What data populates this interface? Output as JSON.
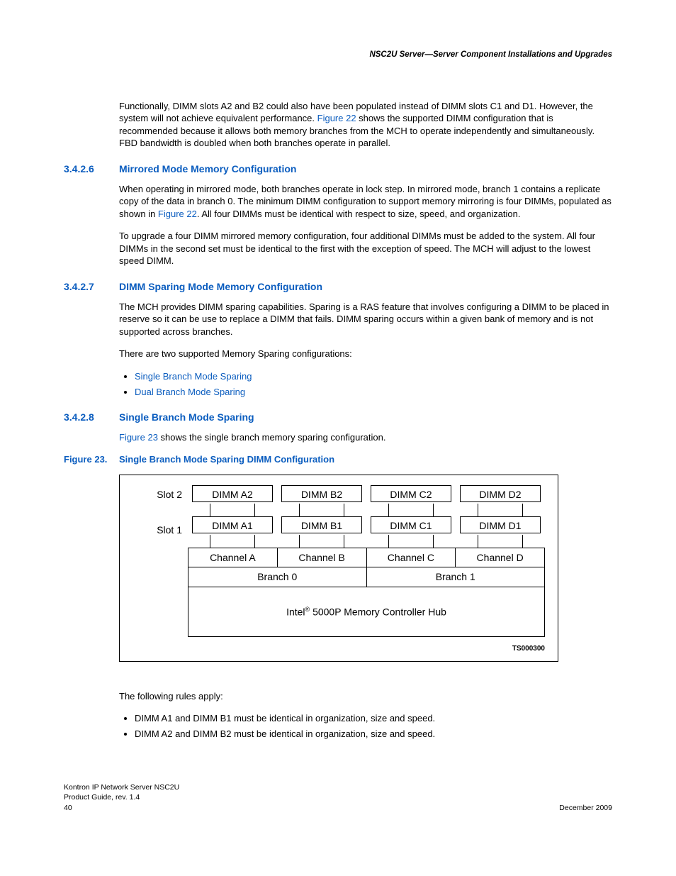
{
  "header": "NSC2U Server—Server Component Installations and Upgrades",
  "intro": {
    "p1a": "Functionally, DIMM slots A2 and B2 could also have been populated instead of DIMM slots C1 and D1. However, the system will not achieve equivalent performance. ",
    "p1link": "Figure 22",
    "p1b": " shows the supported DIMM configuration that is recommended because it allows both memory branches from the MCH to operate independently and simultaneously. FBD bandwidth is doubled when both branches operate in parallel."
  },
  "s1": {
    "num": "3.4.2.6",
    "title": "Mirrored Mode Memory Configuration",
    "p1a": "When operating in mirrored mode, both branches operate in lock step. In mirrored mode, branch 1 contains a replicate copy of the data in branch 0. The minimum DIMM configuration to support memory mirroring is four DIMMs, populated as shown in ",
    "p1link": "Figure 22",
    "p1b": ". All four DIMMs must be identical with respect to size, speed, and organization.",
    "p2": "To upgrade a four DIMM mirrored memory configuration, four additional DIMMs must be added to the system. All four DIMMs in the second set must be identical to the first with the exception of speed. The MCH will adjust to the lowest speed DIMM."
  },
  "s2": {
    "num": "3.4.2.7",
    "title": "DIMM Sparing Mode Memory Configuration",
    "p1": "The MCH provides DIMM sparing capabilities. Sparing is a RAS feature that involves configuring a DIMM to be placed in reserve so it can be use to replace a DIMM that fails. DIMM sparing occurs within a given bank of memory and is not supported across branches.",
    "p2": "There are two supported Memory Sparing configurations:",
    "li1": "Single Branch Mode Sparing",
    "li2": "Dual Branch Mode Sparing"
  },
  "s3": {
    "num": "3.4.2.8",
    "title": "Single Branch Mode Sparing",
    "p1link": "Figure 23",
    "p1b": " shows the single branch memory sparing configuration."
  },
  "fig": {
    "num": "Figure 23.",
    "title": "Single Branch Mode Sparing DIMM Configuration",
    "slot2": "Slot 2",
    "slot1": "Slot 1",
    "dimms2": [
      "DIMM A2",
      "DIMM B2",
      "DIMM C2",
      "DIMM D2"
    ],
    "dimms1": [
      "DIMM A1",
      "DIMM B1",
      "DIMM C1",
      "DIMM D1"
    ],
    "channels": [
      "Channel A",
      "Channel B",
      "Channel C",
      "Channel D"
    ],
    "branches": [
      "Branch 0",
      "Branch 1"
    ],
    "mch_a": "Intel",
    "mch_b": " 5000P Memory Controller Hub",
    "code": "TS000300"
  },
  "rules": {
    "intro": "The following rules apply:",
    "li1": "DIMM A1 and DIMM B1 must be identical in organization, size and speed.",
    "li2": "DIMM A2 and DIMM B2 must be identical in organization, size and speed."
  },
  "footer": {
    "l1": "Kontron IP Network Server NSC2U",
    "l2": "Product Guide, rev. 1.4",
    "l3": "40",
    "date": "December 2009"
  }
}
